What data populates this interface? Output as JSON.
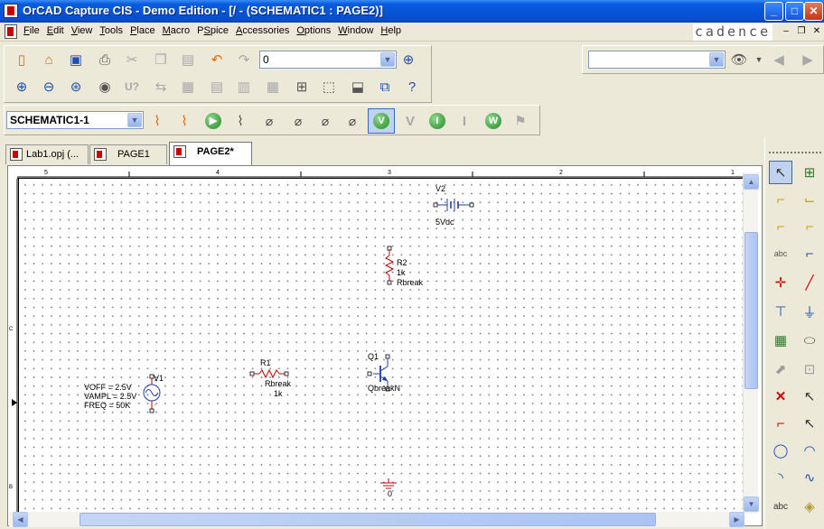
{
  "window": {
    "title": "OrCAD Capture CIS - Demo Edition - [/ - (SCHEMATIC1 : PAGE2)]",
    "controls": {
      "minimize": "_",
      "maximize": "□",
      "close": "✕"
    }
  },
  "menu": {
    "items": [
      {
        "label": "File",
        "underline": "F",
        "rest": "ile"
      },
      {
        "label": "Edit",
        "underline": "E",
        "rest": "dit"
      },
      {
        "label": "View",
        "underline": "V",
        "rest": "iew"
      },
      {
        "label": "Tools",
        "underline": "T",
        "rest": "ools"
      },
      {
        "label": "Place",
        "underline": "P",
        "rest": "lace"
      },
      {
        "label": "Macro",
        "underline": "M",
        "rest": "acro"
      },
      {
        "label": "PSpice",
        "underline": "S",
        "pre": "P",
        "rest": "pice"
      },
      {
        "label": "Accessories",
        "underline": "A",
        "rest": "ccessories"
      },
      {
        "label": "Options",
        "underline": "O",
        "rest": "ptions"
      },
      {
        "label": "Window",
        "underline": "W",
        "rest": "indow"
      },
      {
        "label": "Help",
        "underline": "H",
        "rest": "elp"
      }
    ],
    "brand": "cadence",
    "mdi_controls": {
      "minimize": "–",
      "restore": "❐",
      "close": "✕"
    }
  },
  "toolbar": {
    "zoom_combo_value": "0",
    "search_combo_value": "",
    "schematic_combo_value": "SCHEMATIC1-1",
    "icons_row1": [
      "new-icon",
      "open-icon",
      "save-icon",
      "print-icon",
      "cut-icon",
      "copy-icon",
      "paste-icon",
      "undo-icon",
      "redo-icon",
      "zoom-in-icon"
    ],
    "icons_row2": [
      "zoom-in-icon",
      "zoom-out-icon",
      "zoom-area-icon",
      "zoom-all-icon",
      "annotate-icon",
      "back-annotate-icon",
      "drc-icon",
      "netlist-icon",
      "cross-ref-icon",
      "bom-icon",
      "snap-grid-icon",
      "area-select-icon",
      "drag-icon",
      "project-manager-icon",
      "help-icon"
    ],
    "sim_buttons": {
      "v": "V",
      "i": "I",
      "w": "W",
      "v_gray": "V",
      "i_gray": "I"
    }
  },
  "tabs": [
    {
      "label": "Lab1.opj (...",
      "active": false
    },
    {
      "label": "PAGE1",
      "active": false
    },
    {
      "label": "PAGE2*",
      "active": true
    }
  ],
  "ruler": {
    "top": [
      "5",
      "4",
      "3",
      "2",
      "1"
    ],
    "left": [
      "C",
      "B"
    ]
  },
  "schematic": {
    "v2": {
      "ref": "V2",
      "value": "5Vdc"
    },
    "r2": {
      "ref": "R2",
      "value": "1k",
      "model": "Rbreak"
    },
    "r1": {
      "ref": "R1",
      "model": "Rbreak",
      "value": "1k"
    },
    "q1": {
      "ref": "Q1",
      "model": "QbreakN"
    },
    "v1": {
      "ref": "V1",
      "voff": "VOFF = 2.5V",
      "vampl": "VAMPL = 2.5V",
      "freq": "FREQ = 50K"
    },
    "gnd": {
      "label": "0"
    }
  },
  "palette": {
    "icons": [
      "select-icon",
      "place-part-icon",
      "wire-icon",
      "net-group-icon",
      "auto-wire-icon",
      "auto-wire-multi-icon",
      "bus-icon",
      "net-alias-icon",
      "junction-icon",
      "bus-entry-icon",
      "power-icon",
      "ground-icon",
      "hierarchical-block-icon",
      "port-icon",
      "off-page-connector-icon",
      "pin-icon",
      "no-connect-icon",
      "line-icon",
      "polyline-icon",
      "rectangle-icon",
      "ellipse-icon",
      "arc-icon",
      "elliptical-arc-icon",
      "bezier-icon",
      "text-icon",
      "place-picture-icon"
    ]
  }
}
